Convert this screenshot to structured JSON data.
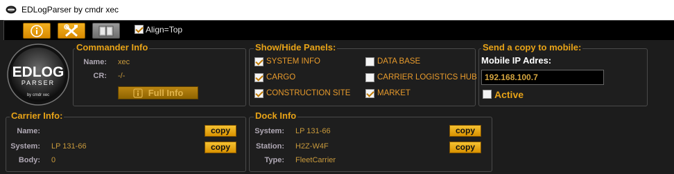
{
  "window": {
    "title": "EDLogParser by cmdr xec"
  },
  "toolbar": {
    "info_icon": "info-icon",
    "settings_icon": "tools-icon",
    "book_icon": "book-icon",
    "align_label": "Align=Top",
    "align_checked": true
  },
  "logo": {
    "main": "EDLOG",
    "sub": "PARSER",
    "credit": "by cmdr xec"
  },
  "commander": {
    "title": "Commander Info",
    "name_label": "Name:",
    "name_value": "xec",
    "cr_label": "CR:",
    "cr_value": "-/-",
    "full_info_label": "Full Info"
  },
  "panels": {
    "title": "Show/Hide Panels:",
    "items": [
      {
        "label": "SYSTEM INFO",
        "checked": true
      },
      {
        "label": "CARGO",
        "checked": true
      },
      {
        "label": "CONSTRUCTION SITE",
        "checked": true
      },
      {
        "label": "DATA BASE",
        "checked": false
      },
      {
        "label": "CARRIER LOGISTICS HUB",
        "checked": false
      },
      {
        "label": "MARKET",
        "checked": true
      }
    ]
  },
  "mobile": {
    "title": "Send a copy to mobile:",
    "ip_label": "Mobile IP Adres:",
    "ip_value": "192.168.100.7",
    "active_label": "Active",
    "active_checked": false
  },
  "carrier": {
    "title": "Carrier Info:",
    "name_label": "Name:",
    "name_value": "",
    "system_label": "System:",
    "system_value": "LP 131-66",
    "body_label": "Body:",
    "body_value": "0",
    "copy_label": "copy"
  },
  "dock": {
    "title": "Dock Info",
    "system_label": "System:",
    "system_value": "LP 131-66",
    "station_label": "Station:",
    "station_value": "H2Z-W4F",
    "type_label": "Type:",
    "type_value": "FleetCarrier",
    "copy_label": "copy"
  },
  "colors": {
    "accent": "#e8a317",
    "value": "#c99a3c",
    "option": "#e89b2c",
    "background": "#1c1c1c"
  }
}
